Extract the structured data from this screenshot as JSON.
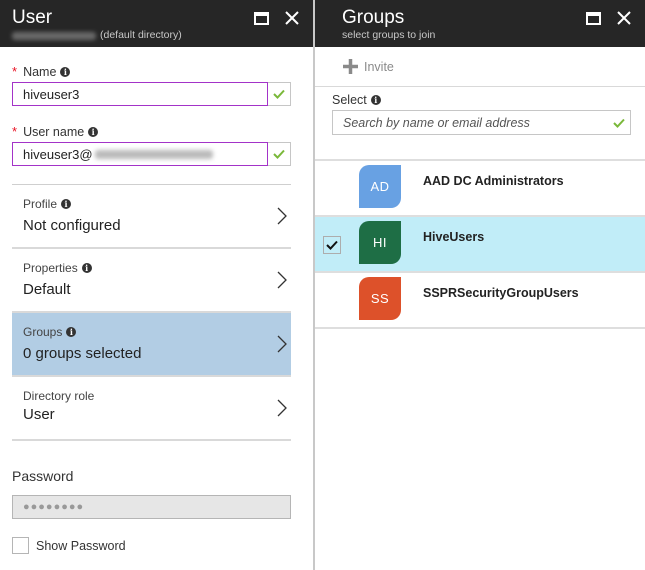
{
  "user_blade": {
    "title": "User",
    "subtitle_suffix": "(default directory)",
    "subtitle_tenant_redacted": true,
    "name_field": {
      "label": "Name",
      "required": true,
      "value": "hiveuser3",
      "valid": true
    },
    "username_field": {
      "label": "User name",
      "required": true,
      "value_prefix": "hiveuser3@",
      "domain_redacted": true,
      "valid": true
    },
    "nav_items": [
      {
        "key": "Profile",
        "value": "Not configured",
        "info": true,
        "selected": false
      },
      {
        "key": "Properties",
        "value": "Default",
        "info": true,
        "selected": false
      },
      {
        "key": "Groups",
        "value": "0 groups selected",
        "info": true,
        "selected": true
      },
      {
        "key": "Directory role",
        "value": "User",
        "info": false,
        "selected": false
      }
    ],
    "password": {
      "label": "Password",
      "masked_value": "●●●●●●●●"
    },
    "show_password": {
      "label": "Show Password",
      "checked": false
    }
  },
  "groups_blade": {
    "title": "Groups",
    "subtitle": "select groups to join",
    "toolbar": {
      "invite_label": "Invite"
    },
    "select": {
      "label": "Select",
      "placeholder": "Search by name or email address"
    },
    "groups": [
      {
        "initials": "AD",
        "name": "AAD DC Administrators",
        "color": "#68a1e3",
        "selected": false
      },
      {
        "initials": "HI",
        "name": "HiveUsers",
        "color": "#1e6e45",
        "selected": true
      },
      {
        "initials": "SS",
        "name": "SSPRSecurityGroupUsers",
        "color": "#dd512a",
        "selected": false
      }
    ]
  },
  "colors": {
    "header_bg": "#262626",
    "selected_nav": "#b2cde4",
    "selected_group": "#c1edf8",
    "valid_check": "#7ab83a",
    "focus_border": "#a333c8",
    "required": "#e81123"
  },
  "icons": {
    "maximize": "maximize-icon",
    "close": "close-icon",
    "info": "info-icon",
    "check": "checkmark-icon",
    "chevron": "chevron-right-icon",
    "plus": "plus-icon"
  }
}
